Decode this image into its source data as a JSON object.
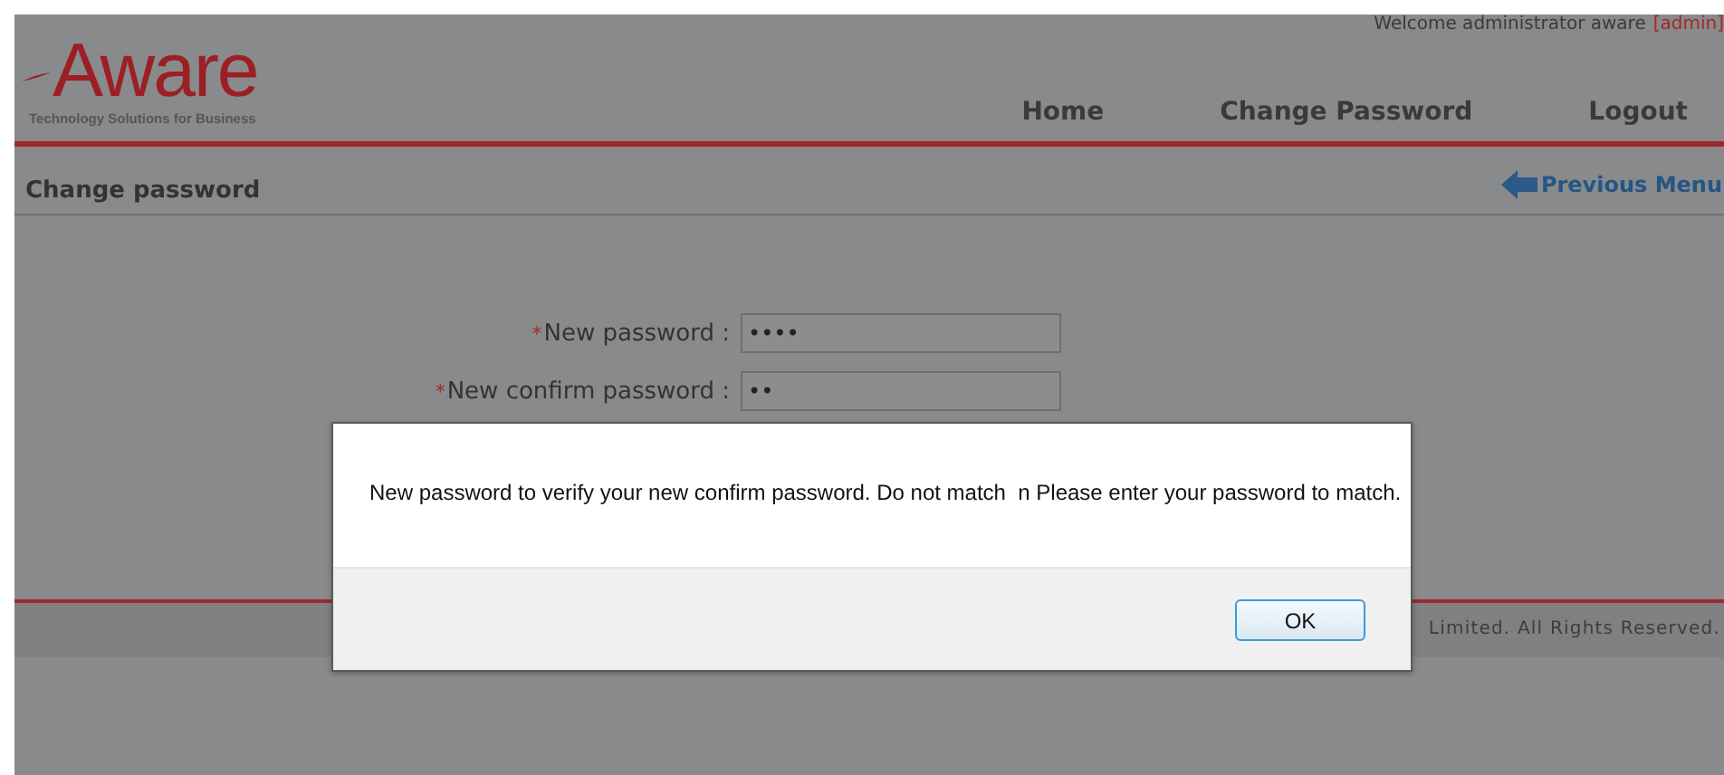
{
  "header": {
    "logo": "Aware",
    "tagline": "Technology Solutions for Business",
    "welcome": "Welcome administrator aware",
    "user_link": "[admin]",
    "nav": [
      {
        "label": "Home"
      },
      {
        "label": "Change Password"
      },
      {
        "label": "Logout"
      }
    ]
  },
  "subheader": {
    "title": "Change password",
    "back_link": "Previous Menu"
  },
  "form": {
    "fields": [
      {
        "marker": "*",
        "label": "New password :",
        "value": "••••"
      },
      {
        "marker": "*",
        "label": "New confirm password :",
        "value": "••"
      }
    ]
  },
  "footer": {
    "text": "Limited. All Rights Reserved."
  },
  "dialog": {
    "message": "New password to verify your new confirm password. Do not match  n Please enter your password to match.",
    "button": "OK"
  }
}
